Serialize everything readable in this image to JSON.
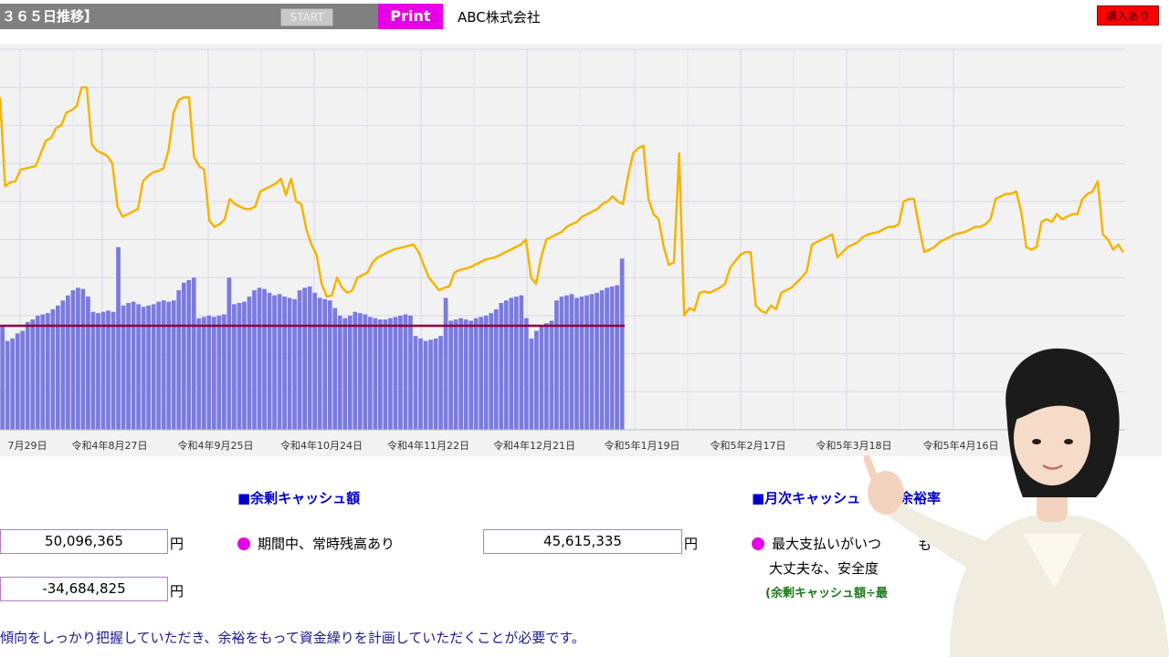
{
  "header": {
    "title": "３６５日推移】",
    "start_label": "START",
    "print_label": "Print",
    "company": "ABC株式会社",
    "buy_label": "購入あり"
  },
  "colors": {
    "bars": "#7b7bdd",
    "line": "#f5b400",
    "baseline": "#8b0040",
    "accent": "#e600e6",
    "section_title": "#0000cc"
  },
  "chart_data": {
    "type": "bar",
    "x_tick_labels": [
      "7月29日",
      "令和4年8月27日",
      "令和4年9月25日",
      "令和4年10月24日",
      "令和4年11月22日",
      "令和4年12月21日",
      "令和5年1月19日",
      "令和5年2月17日",
      "令和5年3月18日",
      "令和5年4月16日"
    ],
    "grid": true,
    "series": [
      {
        "name": "",
        "type": "bar",
        "values": [
          0.82,
          0.7,
          0.72,
          0.76,
          0.78,
          0.85,
          0.87,
          0.9,
          0.91,
          0.92,
          0.95,
          0.98,
          1.02,
          1.06,
          1.1,
          1.12,
          1.11,
          1.05,
          0.93,
          0.92,
          0.93,
          0.94,
          0.93,
          1.44,
          0.98,
          1.0,
          1.01,
          0.99,
          0.97,
          0.98,
          0.99,
          1.01,
          1.02,
          1.01,
          1.02,
          1.1,
          1.16,
          1.18,
          1.2,
          0.88,
          0.89,
          0.9,
          0.89,
          0.9,
          0.91,
          1.2,
          0.99,
          1.0,
          1.01,
          1.05,
          1.1,
          1.12,
          1.11,
          1.08,
          1.06,
          1.07,
          1.05,
          1.04,
          1.03,
          1.1,
          1.12,
          1.13,
          1.08,
          1.04,
          1.03,
          1.02,
          0.96,
          0.9,
          0.88,
          0.9,
          0.93,
          0.92,
          0.91,
          0.89,
          0.88,
          0.87,
          0.87,
          0.88,
          0.89,
          0.9,
          0.91,
          0.9,
          0.74,
          0.72,
          0.7,
          0.71,
          0.72,
          0.74,
          1.04,
          0.86,
          0.87,
          0.88,
          0.87,
          0.86,
          0.88,
          0.89,
          0.9,
          0.92,
          0.95,
          1.0,
          1.02,
          1.04,
          1.05,
          1.06,
          0.88,
          0.72,
          0.78,
          0.82,
          0.84,
          0.86,
          1.02,
          1.05,
          1.06,
          1.07,
          1.04,
          1.05,
          1.06,
          1.07,
          1.08,
          1.1,
          1.12,
          1.13,
          1.14,
          1.35
        ]
      },
      {
        "name": "",
        "type": "line",
        "values": [
          2.62,
          1.92,
          1.95,
          1.96,
          2.05,
          2.06,
          2.07,
          2.08,
          2.18,
          2.28,
          2.3,
          2.38,
          2.4,
          2.5,
          2.52,
          2.55,
          2.7,
          2.7,
          2.25,
          2.2,
          2.18,
          2.16,
          2.1,
          1.76,
          1.68,
          1.7,
          1.72,
          1.74,
          1.96,
          2.0,
          2.03,
          2.04,
          2.06,
          2.2,
          2.5,
          2.6,
          2.62,
          2.62,
          2.15,
          2.08,
          2.05,
          1.65,
          1.6,
          1.62,
          1.66,
          1.82,
          1.78,
          1.76,
          1.74,
          1.74,
          1.76,
          1.88,
          1.9,
          1.92,
          1.94,
          1.98,
          1.85,
          1.98,
          1.8,
          1.78,
          1.58,
          1.46,
          1.38,
          1.15,
          1.05,
          1.06,
          1.2,
          1.12,
          1.08,
          1.1,
          1.2,
          1.22,
          1.24,
          1.32,
          1.36,
          1.38,
          1.4,
          1.42,
          1.43,
          1.44,
          1.45,
          1.46,
          1.4,
          1.3,
          1.2,
          1.15,
          1.1,
          1.12,
          1.13,
          1.24,
          1.26,
          1.27,
          1.28,
          1.3,
          1.32,
          1.34,
          1.35,
          1.36,
          1.38,
          1.4,
          1.42,
          1.44,
          1.46,
          1.5,
          1.2,
          1.15,
          1.36,
          1.5,
          1.52,
          1.54,
          1.56,
          1.6,
          1.62,
          1.64,
          1.68,
          1.7,
          1.72,
          1.74,
          1.78,
          1.8,
          1.84,
          1.8,
          1.78,
          2.0,
          2.18,
          2.22,
          2.24,
          1.82,
          1.7,
          1.66,
          1.44,
          1.3,
          1.32,
          2.18,
          0.9,
          0.96,
          0.94,
          1.08,
          1.09,
          1.08,
          1.1,
          1.12,
          1.15,
          1.28,
          1.33,
          1.38,
          1.4,
          1.4,
          0.98,
          0.94,
          0.92,
          0.98,
          0.95,
          1.08,
          1.1,
          1.12,
          1.16,
          1.2,
          1.25,
          1.46,
          1.48,
          1.5,
          1.52,
          1.54,
          1.36,
          1.4,
          1.44,
          1.46,
          1.48,
          1.52,
          1.54,
          1.55,
          1.56,
          1.58,
          1.6,
          1.6,
          1.62,
          1.8,
          1.82,
          1.82,
          1.6,
          1.4,
          1.42,
          1.44,
          1.48,
          1.5,
          1.52,
          1.54,
          1.55,
          1.56,
          1.58,
          1.6,
          1.6,
          1.62,
          1.66,
          1.82,
          1.84,
          1.86,
          1.86,
          1.88,
          1.72,
          1.44,
          1.42,
          1.44,
          1.64,
          1.66,
          1.64,
          1.7,
          1.66,
          1.68,
          1.7,
          1.7,
          1.82,
          1.86,
          1.88,
          1.96,
          1.54,
          1.5,
          1.42,
          1.46,
          1.4
        ]
      },
      {
        "name": "",
        "type": "line",
        "values": [
          0.82,
          0.82
        ]
      }
    ]
  },
  "summary": {
    "cash_surplus_title": "■余剰キャッシュ額",
    "monthly_title": "■月次キャッシュ",
    "monthly_title_tail": "余裕率",
    "status_text": "期間中、常時残高あり",
    "value_1": "50,096,365",
    "value_2": "-34,684,825",
    "value_3": "45,615,335",
    "yen": "円",
    "note_1": "最大支払いがいつ",
    "note_1_tail": "も",
    "note_2": "大丈夫な、安全度",
    "formula": "(余剰キャッシュ額÷最",
    "bottom_text": "傾向をしっかり把握していただき、余裕をもって資金繰りを計画していただくことが必要です。"
  }
}
